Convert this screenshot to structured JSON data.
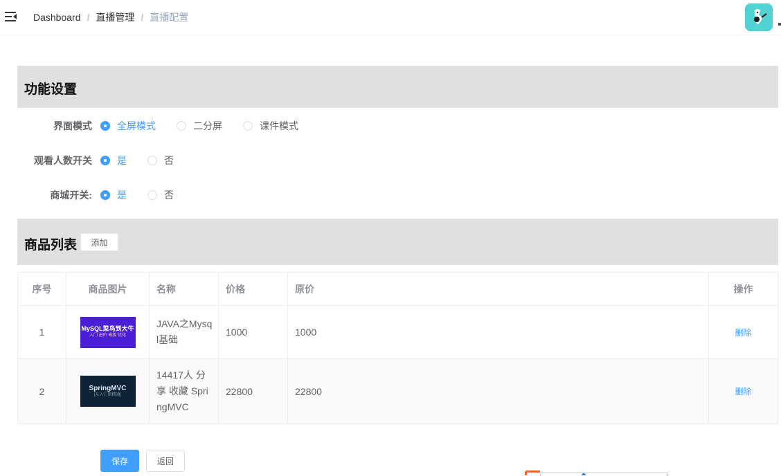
{
  "breadcrumb": {
    "items": [
      "Dashboard",
      "直播管理"
    ],
    "current": "直播配置",
    "separator": "/"
  },
  "icons": {
    "menu": "hamburger-icon",
    "avatar": "user-avatar"
  },
  "settings": {
    "title": "功能设置",
    "ui_mode": {
      "label": "界面模式",
      "options": [
        "全屏模式",
        "二分屏",
        "课件模式"
      ],
      "selected": "全屏模式"
    },
    "viewer_count": {
      "label": "观看人数开关",
      "options": [
        "是",
        "否"
      ],
      "selected": "是"
    },
    "mall": {
      "label": "商城开关:",
      "options": [
        "是",
        "否"
      ],
      "selected": "是"
    }
  },
  "products": {
    "title": "商品列表",
    "add_label": "添加",
    "columns": [
      "序号",
      "商品图片",
      "名称",
      "价格",
      "原价",
      "操作"
    ],
    "rows": [
      {
        "index": "1",
        "thumb_title": "MySQL菜鸟到大牛",
        "thumb_sub": "入门 进阶 高级 优化",
        "name": "JAVA之Mysql基础",
        "price": "1000",
        "original_price": "1000",
        "action": "删除"
      },
      {
        "index": "2",
        "thumb_title": "SpringMVC",
        "thumb_sub": "[从入门到精通]",
        "name": "14417人 分享 收藏 SpringMVC",
        "price": "22800",
        "original_price": "22800",
        "action": "删除"
      }
    ]
  },
  "footer": {
    "save_label": "保存",
    "back_label": "返回"
  },
  "colors": {
    "primary": "#409eff",
    "section_bg": "#e0e0e0",
    "avatar_bg": "#52d2d2"
  }
}
